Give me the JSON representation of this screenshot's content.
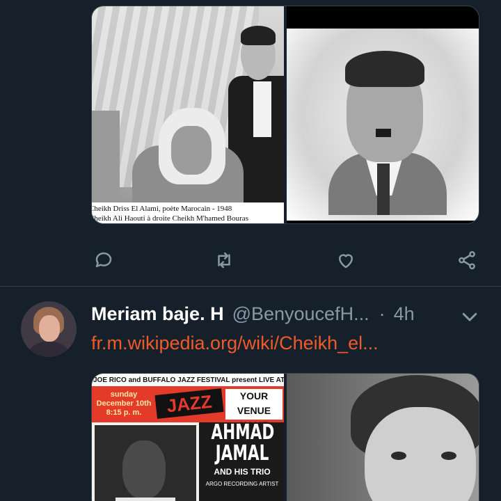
{
  "tweet1": {
    "media": {
      "image_1": {
        "caption_line_1": "Cheikh Driss El Alami, poète Marocain - 1948",
        "caption_line_2": "Cheikh Ali Haouti à droite Cheikh M'hamed Bouras"
      },
      "image_2": {}
    },
    "actions": [
      {
        "icon": "reply-icon"
      },
      {
        "icon": "retweet-icon"
      },
      {
        "icon": "like-icon"
      },
      {
        "icon": "share-icon"
      }
    ]
  },
  "tweet2": {
    "author_name": "Meriam baje. H",
    "handle": "@BenyoucefH...",
    "separator": "·",
    "time": "4h",
    "link_text": "fr.m.wikipedia.org/wiki/Cheikh_el...",
    "media": {
      "poster": {
        "header": "JOE RICO and BUFFALO JAZZ FESTIVAL present LIVE AT THE",
        "day": "sunday",
        "date": "December 10th",
        "time": "8:15 p. m.",
        "logo_text": "JAZZ",
        "venue": "YOUR VENUE NAME HERE",
        "artist_line_1": "AHMAD",
        "artist_line_2": "JAMAL",
        "trio": "AND HIS TRIO",
        "label": "ARGO RECORDING ARTIST"
      }
    }
  },
  "colors": {
    "background": "#15202b",
    "divider": "#38444d",
    "secondary_text": "#8899a6",
    "link": "#f05a28"
  }
}
